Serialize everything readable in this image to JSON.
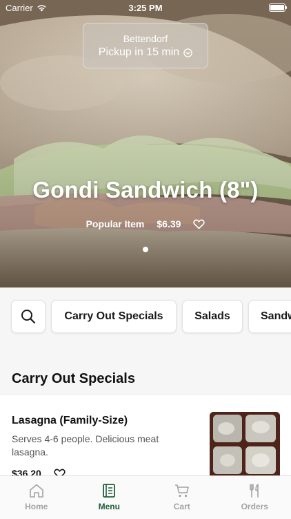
{
  "status_bar": {
    "carrier": "Carrier",
    "time": "3:25 PM"
  },
  "pickup": {
    "location": "Bettendorf",
    "eta": "Pickup in 15 min"
  },
  "hero": {
    "title": "Gondi Sandwich (8\")",
    "tag": "Popular Item",
    "price": "$6.39"
  },
  "categories": [
    "Carry Out Specials",
    "Salads",
    "Sandwiches"
  ],
  "section": {
    "title": "Carry Out Specials"
  },
  "item": {
    "name": "Lasagna (Family-Size)",
    "description": "Serves 4-6 people. Delicious meat lasagna.",
    "price": "$36.20"
  },
  "tabs": [
    {
      "label": "Home",
      "icon": "home-icon"
    },
    {
      "label": "Menu",
      "icon": "menu-icon",
      "active": true
    },
    {
      "label": "Cart",
      "icon": "cart-icon"
    },
    {
      "label": "Orders",
      "icon": "utensils-icon"
    }
  ],
  "colors": {
    "accent": "#1e5c3a",
    "inactive": "#a3a3a3"
  }
}
